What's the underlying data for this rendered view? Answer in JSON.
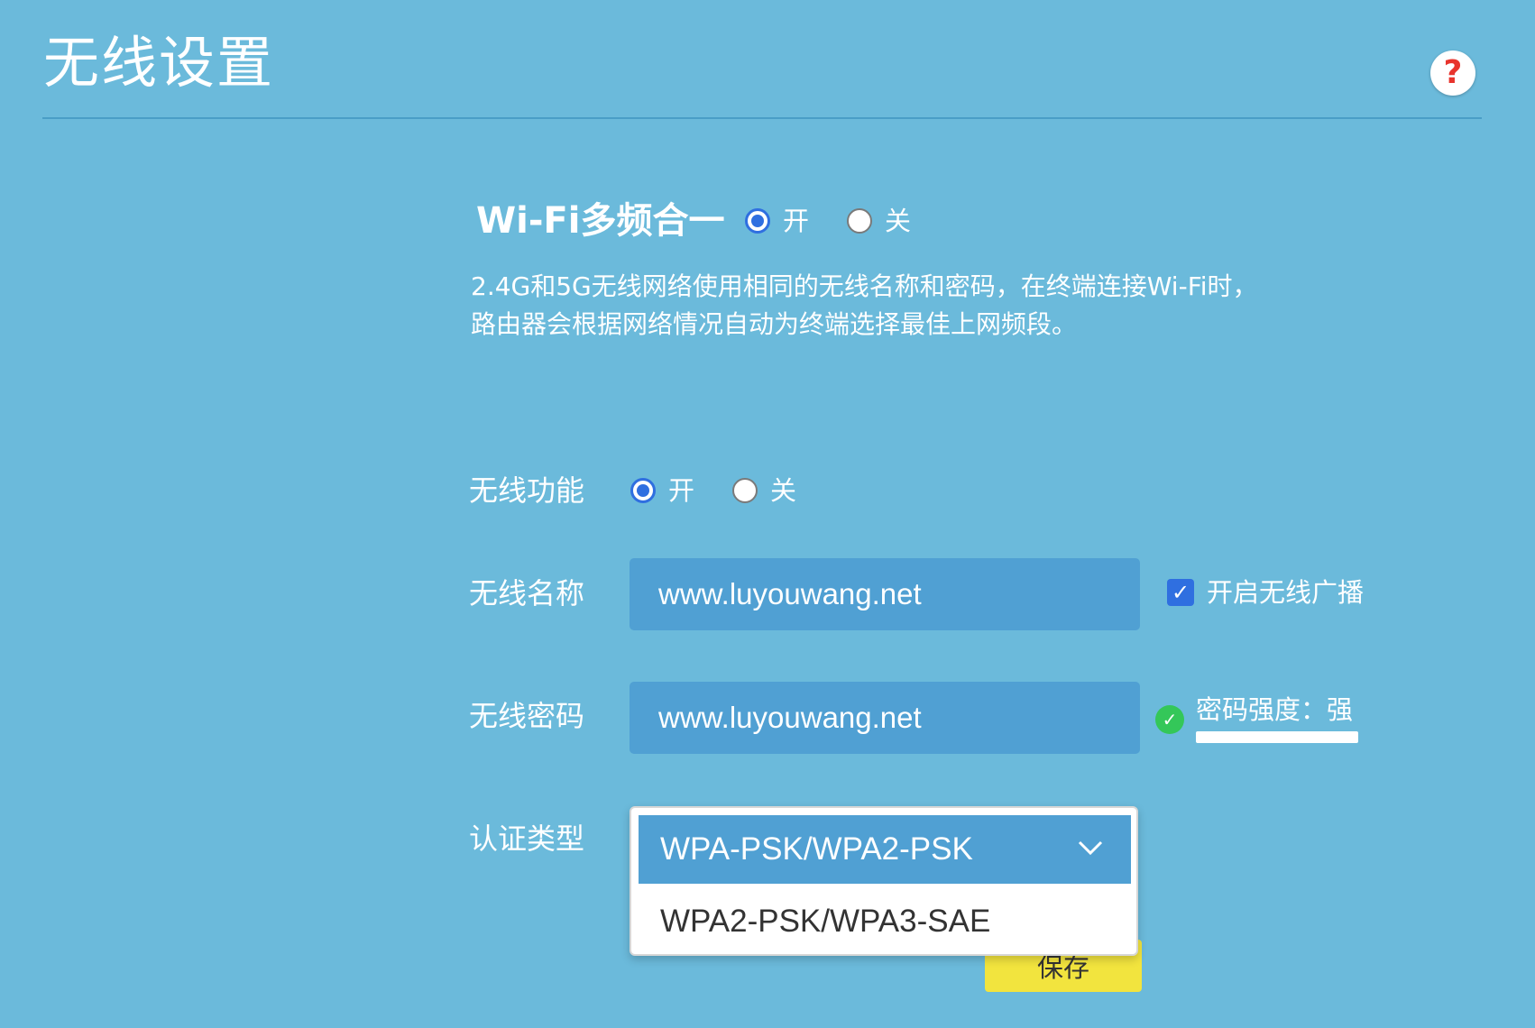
{
  "header": {
    "title": "无线设置",
    "help_label": "?"
  },
  "multiband": {
    "label": "Wi-Fi多频合一",
    "on_label": "开",
    "off_label": "关",
    "selected": "on",
    "description_line1": "2.4G和5G无线网络使用相同的无线名称和密码，在终端连接Wi-Fi时，",
    "description_line2": "路由器会根据网络情况自动为终端选择最佳上网频段。"
  },
  "wireless_function": {
    "label": "无线功能",
    "on_label": "开",
    "off_label": "关",
    "selected": "on"
  },
  "ssid": {
    "label": "无线名称",
    "value": "www.luyouwang.net",
    "broadcast_label": "开启无线广播",
    "broadcast_checked": true
  },
  "password": {
    "label": "无线密码",
    "value": "www.luyouwang.net",
    "strength_text": "密码强度：强"
  },
  "auth": {
    "label": "认证类型",
    "selected": "WPA-PSK/WPA2-PSK",
    "option_2": "WPA2-PSK/WPA3-SAE"
  },
  "save_label": "保存",
  "colors": {
    "background": "#6bbadb",
    "input_bg": "#50a0d3",
    "radio_selected": "#2f6fe0",
    "save_button": "#f2e43e",
    "help_icon": "#e8342d",
    "strength_ok": "#34c759"
  }
}
